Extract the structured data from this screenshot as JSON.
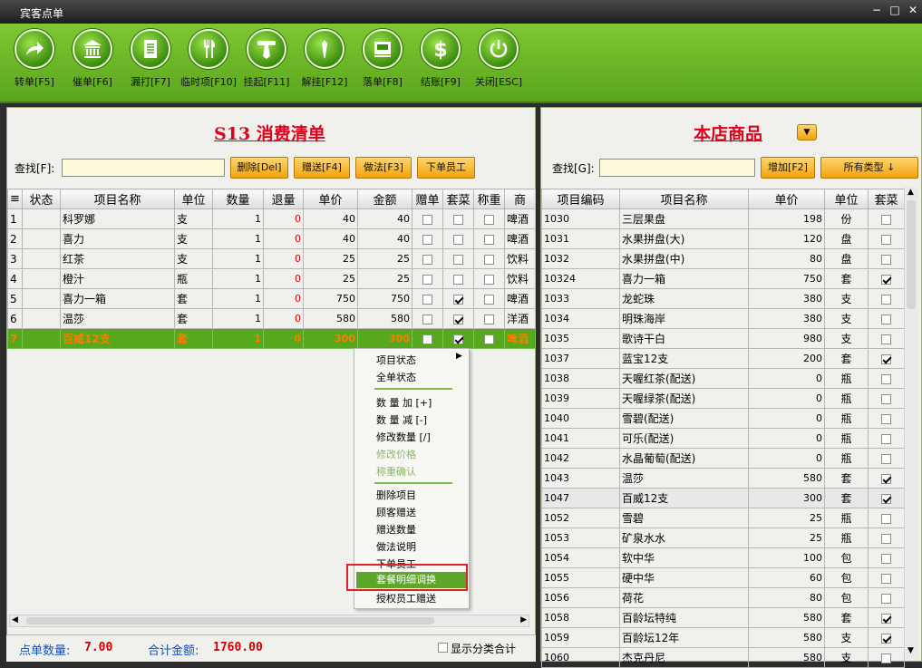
{
  "window": {
    "title": "宾客点单",
    "minimize": "−",
    "maximize": "□",
    "close": "✕"
  },
  "toolbar": [
    {
      "label": "转单[F5]",
      "icon": "transfer-arrow-icon"
    },
    {
      "label": "催单[F6]",
      "icon": "bank-building-icon"
    },
    {
      "label": "漏打[F7]",
      "icon": "document-icon"
    },
    {
      "label": "临时项[F10]",
      "icon": "fork-knife-icon"
    },
    {
      "label": "挂起[F11]",
      "icon": "hang-tie-icon"
    },
    {
      "label": "解挂[F12]",
      "icon": "untie-icon"
    },
    {
      "label": "落单[F8]",
      "icon": "tray-icon"
    },
    {
      "label": "结账[F9]",
      "icon": "dollar-icon"
    },
    {
      "label": "关闭[ESC]",
      "icon": "power-icon"
    }
  ],
  "left": {
    "title": "S13 消费清单",
    "search_label": "查找[F]:",
    "search_value": "",
    "buttons": [
      "删除[Del]",
      "赠送[F4]",
      "做法[F3]",
      "下单员工"
    ],
    "columns": [
      "≡",
      "状态",
      "项目名称",
      "单位",
      "数量",
      "退量",
      "单价",
      "金额",
      "赠单",
      "套菜",
      "称重",
      "商"
    ],
    "rows": [
      {
        "no": "1",
        "status": "",
        "name": "科罗娜",
        "unit": "支",
        "qty": "1",
        "ret": "0",
        "price": "40",
        "amt": "40",
        "gift": false,
        "set": false,
        "weigh": false,
        "cat": "啤酒"
      },
      {
        "no": "2",
        "status": "",
        "name": "喜力",
        "unit": "支",
        "qty": "1",
        "ret": "0",
        "price": "40",
        "amt": "40",
        "gift": false,
        "set": false,
        "weigh": false,
        "cat": "啤酒"
      },
      {
        "no": "3",
        "status": "",
        "name": "红茶",
        "unit": "支",
        "qty": "1",
        "ret": "0",
        "price": "25",
        "amt": "25",
        "gift": false,
        "set": false,
        "weigh": false,
        "cat": "饮料"
      },
      {
        "no": "4",
        "status": "",
        "name": "橙汁",
        "unit": "瓶",
        "qty": "1",
        "ret": "0",
        "price": "25",
        "amt": "25",
        "gift": false,
        "set": false,
        "weigh": false,
        "cat": "饮料"
      },
      {
        "no": "5",
        "status": "",
        "name": "喜力一箱",
        "unit": "套",
        "qty": "1",
        "ret": "0",
        "price": "750",
        "amt": "750",
        "gift": false,
        "set": true,
        "weigh": false,
        "cat": "啤酒"
      },
      {
        "no": "6",
        "status": "",
        "name": "温莎",
        "unit": "套",
        "qty": "1",
        "ret": "0",
        "price": "580",
        "amt": "580",
        "gift": false,
        "set": true,
        "weigh": false,
        "cat": "洋酒"
      },
      {
        "no": "7",
        "status": "",
        "name": "百威12支",
        "unit": "套",
        "qty": "1",
        "ret": "0",
        "price": "300",
        "amt": "300",
        "gift": false,
        "set": true,
        "weigh": false,
        "cat": "啤酒"
      }
    ],
    "status": {
      "count_label": "点单数量:",
      "count": "7.00",
      "total_label": "合计金额:",
      "total": "1760.00",
      "show_cat": "显示分类合计"
    }
  },
  "context_menu": {
    "items": [
      "项目状态",
      "全单状态",
      "数 量 加 [+]",
      "数 量 减 [-]",
      "修改数量 [/]",
      "修改价格",
      "称重确认",
      "删除项目",
      "顾客赠送",
      "赠送数量",
      "做法说明",
      "下单员工",
      "套餐明细调换",
      "授权员工赠送"
    ]
  },
  "right": {
    "title": "本店商品",
    "search_label": "查找[G]:",
    "search_value": "",
    "add_button": "增加[F2]",
    "type_button": "所有类型 ↓",
    "columns": [
      "项目编码",
      "项目名称",
      "单价",
      "单位",
      "套菜"
    ],
    "rows": [
      {
        "code": "1030",
        "name": "三层果盘",
        "price": "198",
        "unit": "份",
        "set": false
      },
      {
        "code": "1031",
        "name": "水果拼盘(大)",
        "price": "120",
        "unit": "盘",
        "set": false
      },
      {
        "code": "1032",
        "name": "水果拼盘(中)",
        "price": "80",
        "unit": "盘",
        "set": false
      },
      {
        "code": "10324",
        "name": "喜力一箱",
        "price": "750",
        "unit": "套",
        "set": true
      },
      {
        "code": "1033",
        "name": "龙蛇珠",
        "price": "380",
        "unit": "支",
        "set": false
      },
      {
        "code": "1034",
        "name": "明珠海岸",
        "price": "380",
        "unit": "支",
        "set": false
      },
      {
        "code": "1035",
        "name": "歌诗干白",
        "price": "980",
        "unit": "支",
        "set": false
      },
      {
        "code": "1037",
        "name": "蓝宝12支",
        "price": "200",
        "unit": "套",
        "set": true
      },
      {
        "code": "1038",
        "name": "天喔红茶(配送)",
        "price": "0",
        "unit": "瓶",
        "set": false
      },
      {
        "code": "1039",
        "name": "天喔绿茶(配送)",
        "price": "0",
        "unit": "瓶",
        "set": false
      },
      {
        "code": "1040",
        "name": "雪碧(配送)",
        "price": "0",
        "unit": "瓶",
        "set": false
      },
      {
        "code": "1041",
        "name": "可乐(配送)",
        "price": "0",
        "unit": "瓶",
        "set": false
      },
      {
        "code": "1042",
        "name": "水晶葡萄(配送)",
        "price": "0",
        "unit": "瓶",
        "set": false
      },
      {
        "code": "1043",
        "name": "温莎",
        "price": "580",
        "unit": "套",
        "set": true
      },
      {
        "code": "1047",
        "name": "百威12支",
        "price": "300",
        "unit": "套",
        "set": true
      },
      {
        "code": "1052",
        "name": "雪碧",
        "price": "25",
        "unit": "瓶",
        "set": false
      },
      {
        "code": "1053",
        "name": "矿泉水水",
        "price": "25",
        "unit": "瓶",
        "set": false
      },
      {
        "code": "1054",
        "name": "软中华",
        "price": "100",
        "unit": "包",
        "set": false
      },
      {
        "code": "1055",
        "name": "硬中华",
        "price": "60",
        "unit": "包",
        "set": false
      },
      {
        "code": "1056",
        "name": "荷花",
        "price": "80",
        "unit": "包",
        "set": false
      },
      {
        "code": "1058",
        "name": "百龄坛特纯",
        "price": "580",
        "unit": "套",
        "set": true
      },
      {
        "code": "1059",
        "name": "百龄坛12年",
        "price": "580",
        "unit": "支",
        "set": true
      },
      {
        "code": "1060",
        "name": "杰克丹尼",
        "price": "580",
        "unit": "支",
        "set": false
      }
    ]
  }
}
